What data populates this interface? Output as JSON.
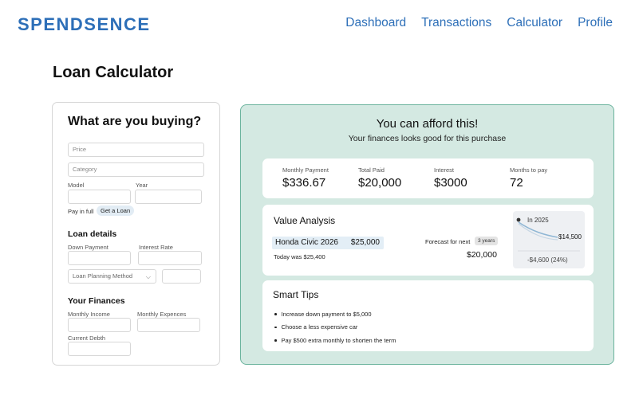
{
  "brand": {
    "logo_text": "SPENDSENCE",
    "color": "#2d6fb8"
  },
  "nav": {
    "items": [
      "Dashboard",
      "Transactions",
      "Calculator",
      "Profile"
    ]
  },
  "page": {
    "title": "Loan Calculator"
  },
  "form": {
    "heading": "What are you buying?",
    "price_placeholder": "Price",
    "category_placeholder": "Category",
    "model_label": "Model",
    "year_label": "Year",
    "pay_in_full": "Pay in full",
    "get_a_loan": "Get a Loan",
    "loan_details_heading": "Loan details",
    "down_payment_label": "Down Payment",
    "interest_rate_label": "Interest Rate",
    "loan_planning_method": "Loan Planning Method",
    "finances_heading": "Your Finances",
    "monthly_income_label": "Monthly Income",
    "monthly_expences_label": "Monthly Expences",
    "current_debth_label": "Current Debth"
  },
  "result": {
    "title": "You can afford this!",
    "subtitle": "Your finances looks good for this purchase",
    "accent": "#6bb39d",
    "background": "#d4e9e2",
    "stats": [
      {
        "label": "Monthly Payment",
        "value": "$336.67"
      },
      {
        "label": "Total Paid",
        "value": "$20,000"
      },
      {
        "label": "Interest",
        "value": "$3000"
      },
      {
        "label": "Months to pay",
        "value": "72"
      }
    ],
    "value_analysis": {
      "title": "Value Analysis",
      "car_name": "Honda Civic 2026",
      "car_price": "$25,000",
      "today_text": "Today was $25,400",
      "forecast_label": "Forecast for next",
      "forecast_years": "3 years",
      "future_value": "$20,000",
      "chart_year": "In 2025",
      "chart_value": "$14,500",
      "chart_drop": "-$4,600 (24%)"
    },
    "tips": {
      "title": "Smart Tips",
      "items": [
        "Increase down payment to $5,000",
        "Choose a less expensive car",
        "Pay $500 extra monthly to shorten the term"
      ]
    }
  }
}
